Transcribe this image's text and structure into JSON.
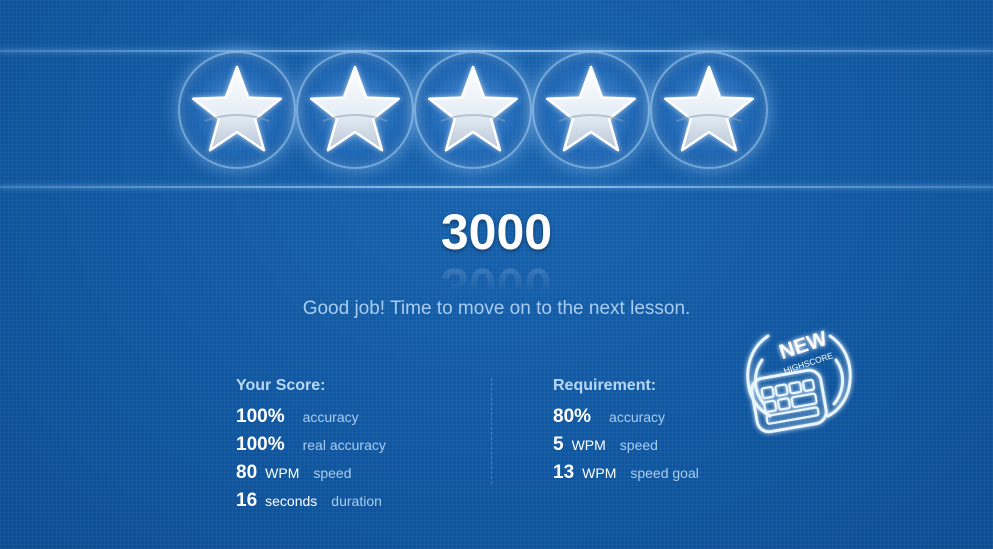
{
  "result": {
    "stars_earned": 5,
    "stars_total": 5,
    "score": "3000",
    "message": "Good job! Time to move on to the next lesson."
  },
  "your_score": {
    "title": "Your Score:",
    "rows": [
      {
        "value": "100%",
        "unit": "",
        "label": "accuracy"
      },
      {
        "value": "100%",
        "unit": "",
        "label": "real accuracy"
      },
      {
        "value": "80",
        "unit": "WPM",
        "label": "speed"
      },
      {
        "value": "16",
        "unit": "seconds",
        "label": "duration"
      }
    ]
  },
  "requirement": {
    "title": "Requirement:",
    "rows": [
      {
        "value": "80%",
        "unit": "",
        "label": "accuracy"
      },
      {
        "value": "5",
        "unit": "WPM",
        "label": "speed"
      },
      {
        "value": "13",
        "unit": "WPM",
        "label": "speed goal"
      }
    ]
  },
  "badge": {
    "line1": "NEW",
    "line2": "HIGHSCORE",
    "icon": "keyboard-icon"
  },
  "colors": {
    "background": "#0e56a0",
    "accent_text": "#a9cdf0",
    "title_text": "#b9d8f5"
  }
}
